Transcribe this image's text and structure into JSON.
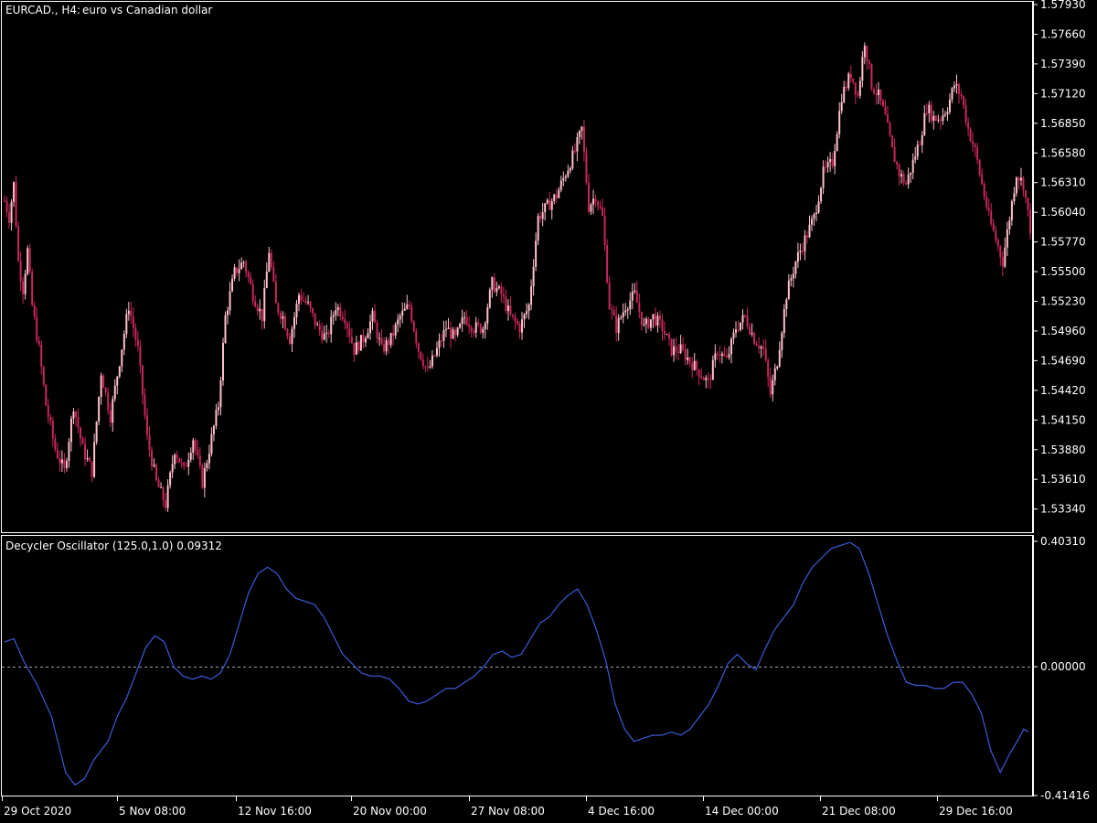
{
  "main_panel": {
    "symbol": "EURCAD., H4:",
    "description": "euro vs Canadian dollar",
    "y_ticks": [
      "1.57930",
      "1.57660",
      "1.57390",
      "1.57120",
      "1.56850",
      "1.56580",
      "1.56310",
      "1.56040",
      "1.55770",
      "1.55500",
      "1.55230",
      "1.54960",
      "1.54690",
      "1.54420",
      "1.54150",
      "1.53880",
      "1.53610",
      "1.53340"
    ]
  },
  "indicator_panel": {
    "label": "Decycler Oscillator (125.0,1.0) 0.09312",
    "y_ticks": [
      "0.40310",
      "0.00000",
      "-0.41416"
    ]
  },
  "x_ticks": [
    "29 Oct 2020",
    "5 Nov 08:00",
    "12 Nov 16:00",
    "20 Nov 00:00",
    "27 Nov 08:00",
    "4 Dec 16:00",
    "14 Dec 00:00",
    "21 Dec 08:00",
    "29 Dec 16:00"
  ],
  "colors": {
    "background": "#000000",
    "frame": "#ffffff",
    "bull_candle": "#ffc0cb",
    "bear_candle": "#c8285a",
    "oscillator_line": "#3c5ad7",
    "zero_line": "#a0a0a0"
  },
  "chart_data": [
    {
      "type": "candlestick",
      "title": "EURCAD., H4: euro vs Canadian dollar",
      "ylim": [
        1.5314,
        1.5796
      ],
      "series": [
        {
          "name": "EURCAD.",
          "note_anchors": [
            [
              0,
              1.5615
            ],
            [
              2,
              1.56
            ],
            [
              4,
              1.563
            ],
            [
              6,
              1.556
            ],
            [
              8,
              1.5535
            ],
            [
              10,
              1.557
            ],
            [
              12,
              1.552
            ],
            [
              15,
              1.548
            ],
            [
              18,
              1.543
            ],
            [
              22,
              1.539
            ],
            [
              26,
              1.537
            ],
            [
              30,
              1.543
            ],
            [
              34,
              1.539
            ],
            [
              38,
              1.537
            ],
            [
              42,
              1.546
            ],
            [
              46,
              1.542
            ],
            [
              50,
              1.547
            ],
            [
              54,
              1.552
            ],
            [
              58,
              1.548
            ],
            [
              62,
              1.54
            ],
            [
              66,
              1.536
            ],
            [
              70,
              1.534
            ],
            [
              74,
              1.539
            ],
            [
              78,
              1.537
            ],
            [
              82,
              1.54
            ],
            [
              86,
              1.536
            ],
            [
              90,
              1.54
            ],
            [
              93,
              1.543
            ],
            [
              96,
              1.551
            ],
            [
              100,
              1.555
            ],
            [
              104,
              1.556
            ],
            [
              108,
              1.553
            ],
            [
              112,
              1.551
            ],
            [
              115,
              1.557
            ],
            [
              118,
              1.552
            ],
            [
              121,
              1.551
            ],
            [
              124,
              1.549
            ],
            [
              128,
              1.553
            ],
            [
              132,
              1.552
            ],
            [
              136,
              1.55
            ],
            [
              140,
              1.549
            ],
            [
              144,
              1.552
            ],
            [
              148,
              1.551
            ],
            [
              152,
              1.548
            ],
            [
              156,
              1.549
            ],
            [
              160,
              1.551
            ],
            [
              164,
              1.548
            ],
            [
              168,
              1.549
            ],
            [
              172,
              1.551
            ],
            [
              176,
              1.552
            ],
            [
              180,
              1.548
            ],
            [
              184,
              1.546
            ],
            [
              188,
              1.548
            ],
            [
              192,
              1.55
            ],
            [
              196,
              1.549
            ],
            [
              200,
              1.551
            ],
            [
              204,
              1.55
            ],
            [
              208,
              1.55
            ],
            [
              212,
              1.554
            ],
            [
              216,
              1.553
            ],
            [
              220,
              1.551
            ],
            [
              224,
              1.55
            ],
            [
              228,
              1.552
            ],
            [
              232,
              1.56
            ],
            [
              236,
              1.561
            ],
            [
              240,
              1.562
            ],
            [
              244,
              1.564
            ],
            [
              248,
              1.566
            ],
            [
              251,
              1.568
            ],
            [
              254,
              1.561
            ],
            [
              257,
              1.562
            ],
            [
              260,
              1.56
            ],
            [
              263,
              1.552
            ],
            [
              266,
              1.55
            ],
            [
              270,
              1.552
            ],
            [
              274,
              1.553
            ],
            [
              278,
              1.55
            ],
            [
              282,
              1.551
            ],
            [
              286,
              1.55
            ],
            [
              290,
              1.548
            ],
            [
              294,
              1.548
            ],
            [
              298,
              1.547
            ],
            [
              302,
              1.546
            ],
            [
              306,
              1.545
            ],
            [
              310,
              1.548
            ],
            [
              314,
              1.547
            ],
            [
              318,
              1.55
            ],
            [
              322,
              1.551
            ],
            [
              326,
              1.549
            ],
            [
              330,
              1.548
            ],
            [
              333,
              1.544
            ],
            [
              336,
              1.547
            ],
            [
              340,
              1.553
            ],
            [
              344,
              1.556
            ],
            [
              348,
              1.558
            ],
            [
              352,
              1.56
            ],
            [
              356,
              1.564
            ],
            [
              360,
              1.565
            ],
            [
              364,
              1.571
            ],
            [
              368,
              1.573
            ],
            [
              371,
              1.571
            ],
            [
              374,
              1.576
            ],
            [
              377,
              1.572
            ],
            [
              380,
              1.571
            ],
            [
              383,
              1.569
            ],
            [
              386,
              1.566
            ],
            [
              389,
              1.564
            ],
            [
              392,
              1.563
            ],
            [
              395,
              1.565
            ],
            [
              398,
              1.567
            ],
            [
              401,
              1.57
            ],
            [
              404,
              1.569
            ],
            [
              407,
              1.569
            ],
            [
              410,
              1.57
            ],
            [
              413,
              1.572
            ],
            [
              416,
              1.571
            ],
            [
              419,
              1.568
            ],
            [
              422,
              1.566
            ],
            [
              425,
              1.563
            ],
            [
              428,
              1.56
            ],
            [
              431,
              1.558
            ],
            [
              434,
              1.556
            ],
            [
              437,
              1.56
            ],
            [
              440,
              1.564
            ],
            [
              443,
              1.563
            ],
            [
              446,
              1.559
            ]
          ]
        }
      ]
    },
    {
      "type": "line",
      "title": "Decycler Oscillator (125.0,1.0) 0.09312",
      "ylim": [
        -0.41416,
        0.4031
      ],
      "series": [
        {
          "name": "Decycler Oscillator",
          "points": [
            [
              0,
              0.08
            ],
            [
              4,
              0.09
            ],
            [
              8,
              0.02
            ],
            [
              14,
              -0.06
            ],
            [
              20,
              -0.16
            ],
            [
              26,
              -0.34
            ],
            [
              30,
              -0.38
            ],
            [
              34,
              -0.36
            ],
            [
              38,
              -0.3
            ],
            [
              44,
              -0.24
            ],
            [
              48,
              -0.16
            ],
            [
              52,
              -0.1
            ],
            [
              56,
              -0.02
            ],
            [
              60,
              0.06
            ],
            [
              64,
              0.1
            ],
            [
              68,
              0.08
            ],
            [
              72,
              0.0
            ],
            [
              76,
              -0.03
            ],
            [
              80,
              -0.04
            ],
            [
              84,
              -0.03
            ],
            [
              88,
              -0.04
            ],
            [
              92,
              -0.02
            ],
            [
              96,
              0.04
            ],
            [
              100,
              0.14
            ],
            [
              104,
              0.24
            ],
            [
              108,
              0.3
            ],
            [
              112,
              0.32
            ],
            [
              116,
              0.3
            ],
            [
              120,
              0.25
            ],
            [
              124,
              0.22
            ],
            [
              128,
              0.21
            ],
            [
              132,
              0.2
            ],
            [
              136,
              0.16
            ],
            [
              140,
              0.1
            ],
            [
              144,
              0.04
            ],
            [
              148,
              0.01
            ],
            [
              152,
              -0.02
            ],
            [
              156,
              -0.03
            ],
            [
              160,
              -0.03
            ],
            [
              164,
              -0.04
            ],
            [
              168,
              -0.07
            ],
            [
              172,
              -0.11
            ],
            [
              176,
              -0.12
            ],
            [
              180,
              -0.11
            ],
            [
              184,
              -0.09
            ],
            [
              188,
              -0.07
            ],
            [
              192,
              -0.07
            ],
            [
              196,
              -0.05
            ],
            [
              200,
              -0.03
            ],
            [
              204,
              0.0
            ],
            [
              208,
              0.04
            ],
            [
              212,
              0.05
            ],
            [
              216,
              0.03
            ],
            [
              220,
              0.04
            ],
            [
              224,
              0.09
            ],
            [
              228,
              0.14
            ],
            [
              232,
              0.16
            ],
            [
              236,
              0.2
            ],
            [
              240,
              0.23
            ],
            [
              244,
              0.25
            ],
            [
              248,
              0.2
            ],
            [
              252,
              0.12
            ],
            [
              256,
              0.02
            ],
            [
              260,
              -0.12
            ],
            [
              264,
              -0.2
            ],
            [
              268,
              -0.24
            ],
            [
              272,
              -0.23
            ],
            [
              276,
              -0.22
            ],
            [
              280,
              -0.22
            ],
            [
              284,
              -0.21
            ],
            [
              288,
              -0.22
            ],
            [
              292,
              -0.2
            ],
            [
              296,
              -0.16
            ],
            [
              300,
              -0.12
            ],
            [
              304,
              -0.06
            ],
            [
              308,
              0.01
            ],
            [
              312,
              0.04
            ],
            [
              316,
              0.01
            ],
            [
              320,
              -0.01
            ],
            [
              324,
              0.06
            ],
            [
              328,
              0.12
            ],
            [
              332,
              0.16
            ],
            [
              336,
              0.2
            ],
            [
              340,
              0.27
            ],
            [
              344,
              0.32
            ],
            [
              348,
              0.35
            ],
            [
              352,
              0.38
            ],
            [
              356,
              0.39
            ],
            [
              360,
              0.4
            ],
            [
              364,
              0.38
            ],
            [
              368,
              0.3
            ],
            [
              372,
              0.2
            ],
            [
              376,
              0.1
            ],
            [
              380,
              0.02
            ],
            [
              384,
              -0.05
            ],
            [
              388,
              -0.06
            ],
            [
              392,
              -0.06
            ],
            [
              396,
              -0.07
            ],
            [
              400,
              -0.07
            ],
            [
              404,
              -0.05
            ],
            [
              408,
              -0.05
            ],
            [
              412,
              -0.09
            ],
            [
              416,
              -0.15
            ],
            [
              420,
              -0.27
            ],
            [
              424,
              -0.34
            ],
            [
              428,
              -0.28
            ],
            [
              432,
              -0.23
            ],
            [
              434,
              -0.2
            ],
            [
              436,
              -0.21
            ]
          ]
        }
      ]
    }
  ]
}
